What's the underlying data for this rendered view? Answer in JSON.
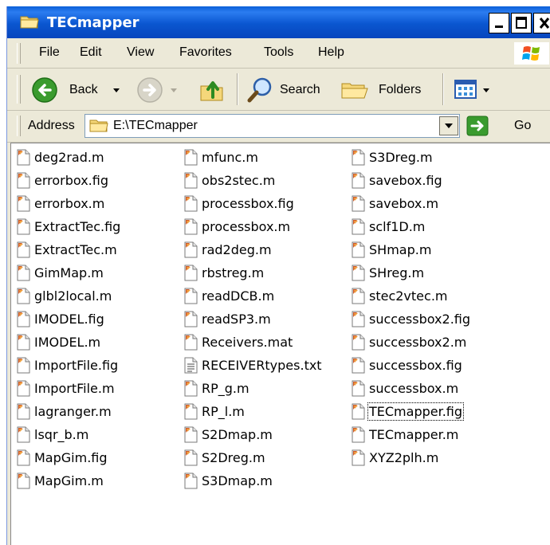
{
  "window": {
    "title": "TECmapper",
    "title_icon": "folder-icon"
  },
  "menu": [
    "File",
    "Edit",
    "View",
    "Favorites",
    "Tools",
    "Help"
  ],
  "toolbar": {
    "back_label": "Back",
    "search_label": "Search",
    "folders_label": "Folders"
  },
  "address": {
    "label": "Address",
    "value": "E:\\TECmapper",
    "go_label": "Go"
  },
  "files": {
    "col1": [
      "deg2rad.m",
      "errorbox.fig",
      "errorbox.m",
      "ExtractTec.fig",
      "ExtractTec.m",
      "GimMap.m",
      "glbl2local.m",
      "IMODEL.fig",
      "IMODEL.m",
      "ImportFile.fig",
      "ImportFile.m",
      "lagranger.m",
      "lsqr_b.m",
      "MapGim.fig",
      "MapGim.m"
    ],
    "col2": [
      "mfunc.m",
      "obs2stec.m",
      "processbox.fig",
      "processbox.m",
      "rad2deg.m",
      "rbstreg.m",
      "readDCB.m",
      "readSP3.m",
      "Receivers.mat",
      "RECEIVERtypes.txt",
      "RP_g.m",
      "RP_l.m",
      "S2Dmap.m",
      "S2Dreg.m",
      "S3Dmap.m"
    ],
    "col3": [
      "S3Dreg.m",
      "savebox.fig",
      "savebox.m",
      "sclf1D.m",
      "SHmap.m",
      "SHreg.m",
      "stec2vtec.m",
      "successbox2.fig",
      "successbox2.m",
      "successbox.fig",
      "successbox.m",
      "TECmapper.fig",
      "TECmapper.m",
      "XYZ2plh.m"
    ]
  },
  "focused_file": "TECmapper.fig",
  "text_file": "RECEIVERtypes.txt"
}
